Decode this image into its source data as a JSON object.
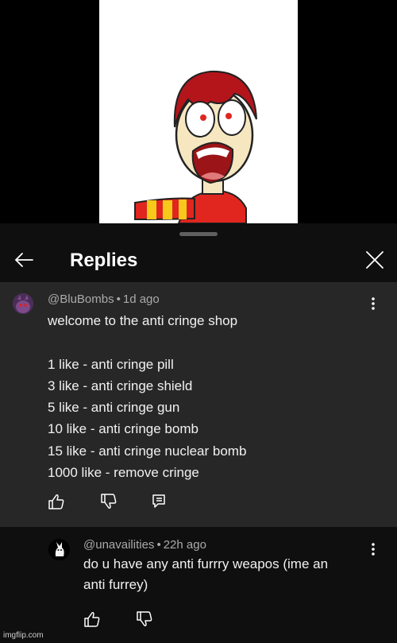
{
  "video": {},
  "sheet": {
    "title": "Replies"
  },
  "comment": {
    "author": "@BluBombs",
    "time": "1d ago",
    "body": "welcome to the anti cringe shop\n\n1 like - anti cringe pill\n3 like - anti cringe shield\n5 like - anti cringe gun\n10 like - anti cringe bomb\n15 like - anti cringe nuclear bomb\n1000 like - remove cringe"
  },
  "reply": {
    "author": "@unavailities",
    "time": "22h ago",
    "body": "do u have any anti furrry weapos (ime an\nanti furrey)"
  },
  "watermark": "imgflip.com",
  "icons": {
    "back": "arrow-left-icon",
    "close": "close-icon",
    "more": "more-vert-icon",
    "like": "thumb-up-icon",
    "dislike": "thumb-down-icon",
    "reply": "reply-icon"
  },
  "colors": {
    "sheet_bg": "#0f0f0f",
    "highlight_bg": "#272727",
    "meta_text": "#aaaaaa"
  }
}
